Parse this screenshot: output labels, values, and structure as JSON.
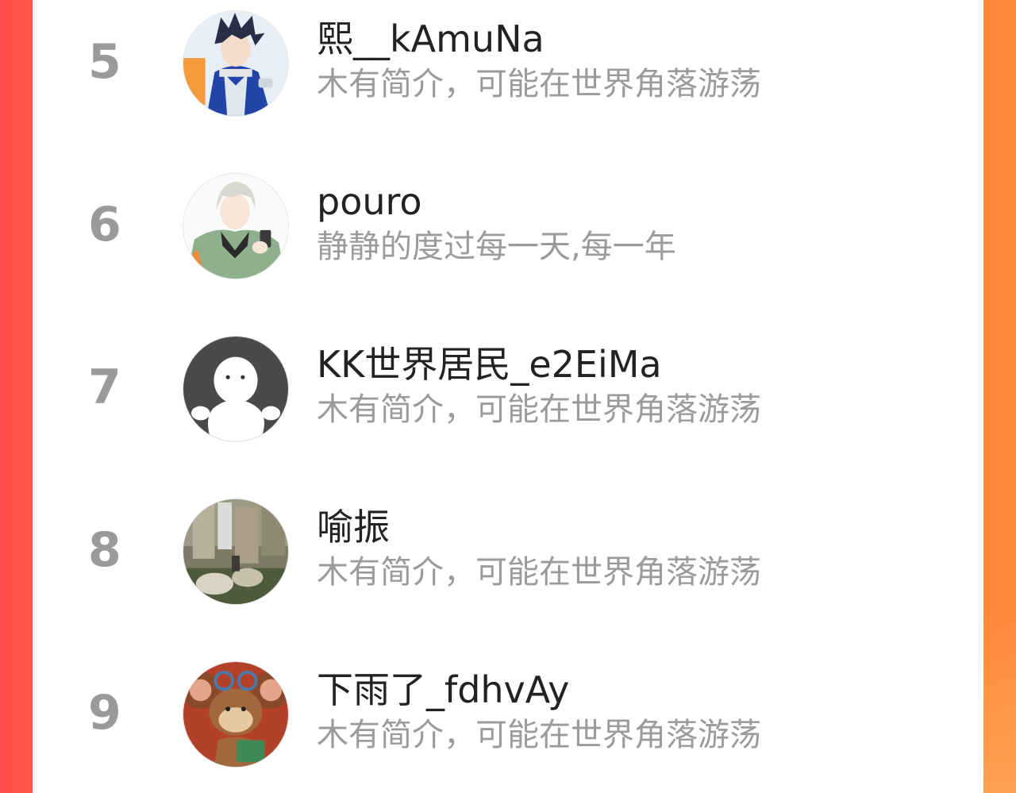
{
  "colors": {
    "background_left": "#ff4d4a",
    "background_right": "#ff8a3a",
    "card": "#ffffff",
    "rank_text": "#9a9a9a",
    "name_text": "#222222",
    "bio_text": "#9b9b9b"
  },
  "ranking": {
    "items": [
      {
        "rank": "5",
        "name": "熙__kAmuNa",
        "bio": "木有简介，可能在世界角落游荡",
        "avatar": "anime-ninja-avatar"
      },
      {
        "rank": "6",
        "name": "pouro",
        "bio": "静静的度过每一天,每一年",
        "avatar": "anime-boy-phone-avatar"
      },
      {
        "rank": "7",
        "name": "KK世界居民_e2EiMa",
        "bio": "木有简介，可能在世界角落游荡",
        "avatar": "default-ghost-avatar"
      },
      {
        "rank": "8",
        "name": "喻振",
        "bio": "木有简介，可能在世界角落游荡",
        "avatar": "waterfall-rocks-avatar"
      },
      {
        "rank": "9",
        "name": "下雨了_fdhvAy",
        "bio": "木有简介，可能在世界角落游荡",
        "avatar": "cartoon-mouse-avatar"
      }
    ]
  }
}
